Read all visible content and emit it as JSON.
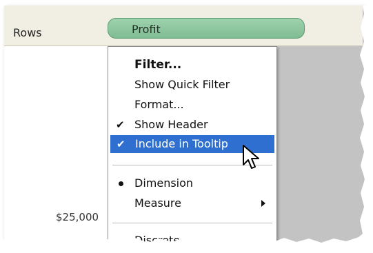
{
  "shelf": {
    "label": "Rows",
    "pill_label": "Profit"
  },
  "axis": {
    "tick_label": "$25,000"
  },
  "context_menu": {
    "items": [
      {
        "label": "Filter...",
        "bold": true
      },
      {
        "label": "Show Quick Filter"
      },
      {
        "label": "Format..."
      },
      {
        "label": "Show Header",
        "checked": true
      },
      {
        "label": "Include in Tooltip",
        "checked": true,
        "highlighted": true
      },
      {
        "label": "Dimension",
        "selected": true
      },
      {
        "label": "Measure",
        "submenu": true
      },
      {
        "label": "Discrete"
      }
    ]
  },
  "colors": {
    "pill": "#8cc7a0",
    "highlight": "#2f6fcf",
    "shelf_bg": "#f1efe4",
    "side_gray": "#c3c3c3"
  },
  "icons": [
    "checkmark-icon",
    "radio-bullet-icon",
    "submenu-arrow-icon",
    "mouse-pointer-icon"
  ]
}
